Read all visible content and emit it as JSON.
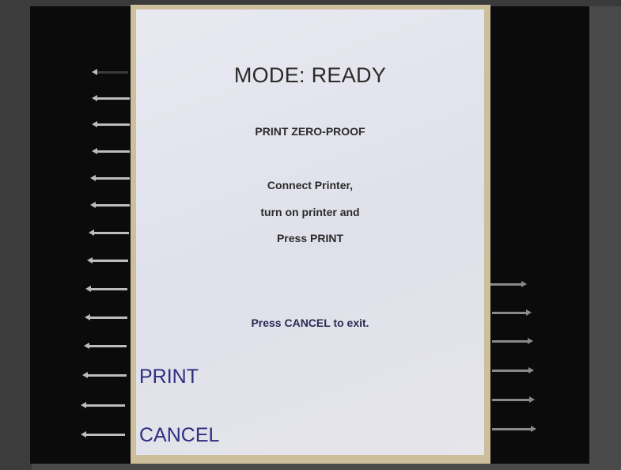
{
  "screen": {
    "mode_title": "MODE: READY",
    "subtitle": "PRINT ZERO-PROOF",
    "instructions": [
      "Connect Printer,",
      "turn on printer and",
      "Press PRINT"
    ],
    "exit_message": "Press CANCEL to exit."
  },
  "softkeys": {
    "print_label": "PRINT",
    "cancel_label": "CANCEL"
  },
  "colors": {
    "screen_background": "#e4e5ee",
    "softkey_text": "#2e2e82",
    "body_text": "#2b2b2b",
    "bezel": "#0b0b0b"
  }
}
